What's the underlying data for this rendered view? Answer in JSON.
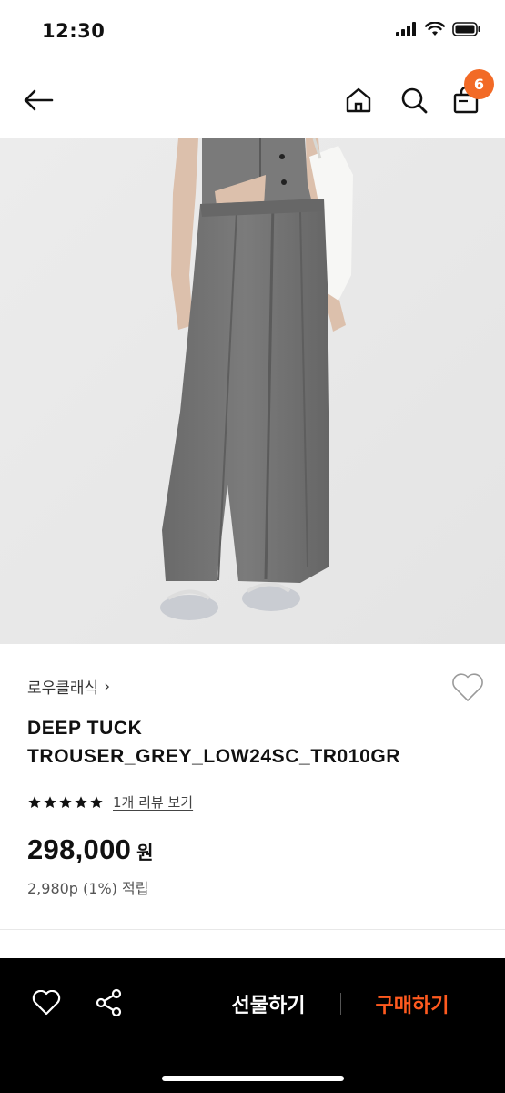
{
  "status_bar": {
    "time": "12:30"
  },
  "header": {
    "cart_count": "6"
  },
  "product": {
    "brand": "로우클래식",
    "brand_chevron": "›",
    "name_line1": "DEEP TUCK",
    "name_line2": "TROUSER_GREY_LOW24SC_TR010GR",
    "rating_stars": 5,
    "review_link": "1개 리뷰 보기",
    "price": "298,000",
    "currency": "원",
    "points": "2,980p (1%) 적립"
  },
  "bottom_bar": {
    "gift_label": "선물하기",
    "buy_label": "구매하기"
  },
  "colors": {
    "accent": "#f26a26",
    "buy_text": "#ff5a1f",
    "bottom_bar_bg": "#000000"
  },
  "icons": [
    "back-arrow-icon",
    "home-icon",
    "search-icon",
    "shopping-bag-icon",
    "heart-icon",
    "share-icon",
    "star-icon"
  ]
}
